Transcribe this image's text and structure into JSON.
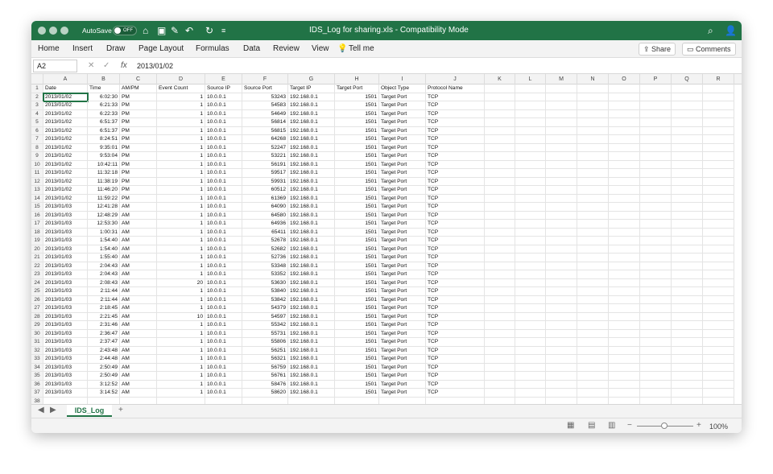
{
  "window": {
    "autosave_label": "AutoSave",
    "autosave_state": "OFF",
    "title": "IDS_Log for sharing.xls  -  Compatibility Mode"
  },
  "menu": [
    "Home",
    "Insert",
    "Draw",
    "Page Layout",
    "Formulas",
    "Data",
    "Review",
    "View",
    "Tell me"
  ],
  "buttons": {
    "share": "Share",
    "comments": "Comments"
  },
  "formula_bar": {
    "cell_ref": "A2",
    "content": "2013/01/02"
  },
  "columns": [
    "A",
    "B",
    "C",
    "D",
    "E",
    "F",
    "G",
    "H",
    "I",
    "J",
    "K",
    "L",
    "M",
    "N",
    "O",
    "P",
    "Q",
    "R"
  ],
  "headers": [
    "Date",
    "Time",
    "AM/PM",
    "Event Count",
    "Source IP",
    "Source Port",
    "Target IP",
    "Target Port",
    "Object Type",
    "Protocol Name"
  ],
  "rows": [
    [
      "2013/01/02",
      "6:02:30",
      "PM",
      "1",
      "10.0.0.1",
      "53243",
      "192.168.0.1",
      "1501",
      "Target Port",
      "TCP"
    ],
    [
      "2013/01/02",
      "6:21:33",
      "PM",
      "1",
      "10.0.0.1",
      "54583",
      "192.168.0.1",
      "1501",
      "Target Port",
      "TCP"
    ],
    [
      "2013/01/02",
      "6:22:33",
      "PM",
      "1",
      "10.0.0.1",
      "54649",
      "192.168.0.1",
      "1501",
      "Target Port",
      "TCP"
    ],
    [
      "2013/01/02",
      "6:51:37",
      "PM",
      "1",
      "10.0.0.1",
      "56814",
      "192.168.0.1",
      "1501",
      "Target Port",
      "TCP"
    ],
    [
      "2013/01/02",
      "6:51:37",
      "PM",
      "1",
      "10.0.0.1",
      "56815",
      "192.168.0.1",
      "1501",
      "Target Port",
      "TCP"
    ],
    [
      "2013/01/02",
      "8:24:51",
      "PM",
      "1",
      "10.0.0.1",
      "64268",
      "192.168.0.1",
      "1501",
      "Target Port",
      "TCP"
    ],
    [
      "2013/01/02",
      "9:35:01",
      "PM",
      "1",
      "10.0.0.1",
      "52247",
      "192.168.0.1",
      "1501",
      "Target Port",
      "TCP"
    ],
    [
      "2013/01/02",
      "9:53:04",
      "PM",
      "1",
      "10.0.0.1",
      "53221",
      "192.168.0.1",
      "1501",
      "Target Port",
      "TCP"
    ],
    [
      "2013/01/02",
      "10:42:11",
      "PM",
      "1",
      "10.0.0.1",
      "56191",
      "192.168.0.1",
      "1501",
      "Target Port",
      "TCP"
    ],
    [
      "2013/01/02",
      "11:32:18",
      "PM",
      "1",
      "10.0.0.1",
      "59517",
      "192.168.0.1",
      "1501",
      "Target Port",
      "TCP"
    ],
    [
      "2013/01/02",
      "11:38:19",
      "PM",
      "1",
      "10.0.0.1",
      "59931",
      "192.168.0.1",
      "1501",
      "Target Port",
      "TCP"
    ],
    [
      "2013/01/02",
      "11:46:20",
      "PM",
      "1",
      "10.0.0.1",
      "60512",
      "192.168.0.1",
      "1501",
      "Target Port",
      "TCP"
    ],
    [
      "2013/01/02",
      "11:59:22",
      "PM",
      "1",
      "10.0.0.1",
      "61369",
      "192.168.0.1",
      "1501",
      "Target Port",
      "TCP"
    ],
    [
      "2013/01/03",
      "12:41:28",
      "AM",
      "1",
      "10.0.0.1",
      "64090",
      "192.168.0.1",
      "1501",
      "Target Port",
      "TCP"
    ],
    [
      "2013/01/03",
      "12:48:29",
      "AM",
      "1",
      "10.0.0.1",
      "64580",
      "192.168.0.1",
      "1501",
      "Target Port",
      "TCP"
    ],
    [
      "2013/01/03",
      "12:53:30",
      "AM",
      "1",
      "10.0.0.1",
      "64936",
      "192.168.0.1",
      "1501",
      "Target Port",
      "TCP"
    ],
    [
      "2013/01/03",
      "1:00:31",
      "AM",
      "1",
      "10.0.0.1",
      "65411",
      "192.168.0.1",
      "1501",
      "Target Port",
      "TCP"
    ],
    [
      "2013/01/03",
      "1:54:40",
      "AM",
      "1",
      "10.0.0.1",
      "52678",
      "192.168.0.1",
      "1501",
      "Target Port",
      "TCP"
    ],
    [
      "2013/01/03",
      "1:54:40",
      "AM",
      "1",
      "10.0.0.1",
      "52682",
      "192.168.0.1",
      "1501",
      "Target Port",
      "TCP"
    ],
    [
      "2013/01/03",
      "1:55:40",
      "AM",
      "1",
      "10.0.0.1",
      "52736",
      "192.168.0.1",
      "1501",
      "Target Port",
      "TCP"
    ],
    [
      "2013/01/03",
      "2:04:43",
      "AM",
      "1",
      "10.0.0.1",
      "53348",
      "192.168.0.1",
      "1501",
      "Target Port",
      "TCP"
    ],
    [
      "2013/01/03",
      "2:04:43",
      "AM",
      "1",
      "10.0.0.1",
      "53352",
      "192.168.0.1",
      "1501",
      "Target Port",
      "TCP"
    ],
    [
      "2013/01/03",
      "2:08:43",
      "AM",
      "20",
      "10.0.0.1",
      "53630",
      "192.168.0.1",
      "1501",
      "Target Port",
      "TCP"
    ],
    [
      "2013/01/03",
      "2:11:44",
      "AM",
      "1",
      "10.0.0.1",
      "53840",
      "192.168.0.1",
      "1501",
      "Target Port",
      "TCP"
    ],
    [
      "2013/01/03",
      "2:11:44",
      "AM",
      "1",
      "10.0.0.1",
      "53842",
      "192.168.0.1",
      "1501",
      "Target Port",
      "TCP"
    ],
    [
      "2013/01/03",
      "2:18:45",
      "AM",
      "1",
      "10.0.0.1",
      "54379",
      "192.168.0.1",
      "1501",
      "Target Port",
      "TCP"
    ],
    [
      "2013/01/03",
      "2:21:45",
      "AM",
      "10",
      "10.0.0.1",
      "54597",
      "192.168.0.1",
      "1501",
      "Target Port",
      "TCP"
    ],
    [
      "2013/01/03",
      "2:31:46",
      "AM",
      "1",
      "10.0.0.1",
      "55342",
      "192.168.0.1",
      "1501",
      "Target Port",
      "TCP"
    ],
    [
      "2013/01/03",
      "2:36:47",
      "AM",
      "1",
      "10.0.0.1",
      "55731",
      "192.168.0.1",
      "1501",
      "Target Port",
      "TCP"
    ],
    [
      "2013/01/03",
      "2:37:47",
      "AM",
      "1",
      "10.0.0.1",
      "55806",
      "192.168.0.1",
      "1501",
      "Target Port",
      "TCP"
    ],
    [
      "2013/01/03",
      "2:43:48",
      "AM",
      "1",
      "10.0.0.1",
      "56251",
      "192.168.0.1",
      "1501",
      "Target Port",
      "TCP"
    ],
    [
      "2013/01/03",
      "2:44:48",
      "AM",
      "1",
      "10.0.0.1",
      "56321",
      "192.168.0.1",
      "1501",
      "Target Port",
      "TCP"
    ],
    [
      "2013/01/03",
      "2:50:49",
      "AM",
      "1",
      "10.0.0.1",
      "56759",
      "192.168.0.1",
      "1501",
      "Target Port",
      "TCP"
    ],
    [
      "2013/01/03",
      "2:50:49",
      "AM",
      "1",
      "10.0.0.1",
      "56761",
      "192.168.0.1",
      "1501",
      "Target Port",
      "TCP"
    ],
    [
      "2013/01/03",
      "3:12:52",
      "AM",
      "1",
      "10.0.0.1",
      "58476",
      "192.168.0.1",
      "1501",
      "Target Port",
      "TCP"
    ],
    [
      "2013/01/03",
      "3:14:52",
      "AM",
      "1",
      "10.0.0.1",
      "58620",
      "192.168.0.1",
      "1501",
      "Target Port",
      "TCP"
    ]
  ],
  "sheet_tab": "IDS_Log",
  "zoom": "100%",
  "icons": [
    "home-icon",
    "save-icon",
    "edit-icon",
    "undo-icon",
    "redo-icon",
    "more-icon",
    "search-icon",
    "person-icon",
    "lightbulb-icon",
    "share-icon",
    "comment-icon",
    "normal-view-icon",
    "page-layout-icon",
    "page-break-icon"
  ],
  "colors": {
    "accent": "#217346"
  }
}
